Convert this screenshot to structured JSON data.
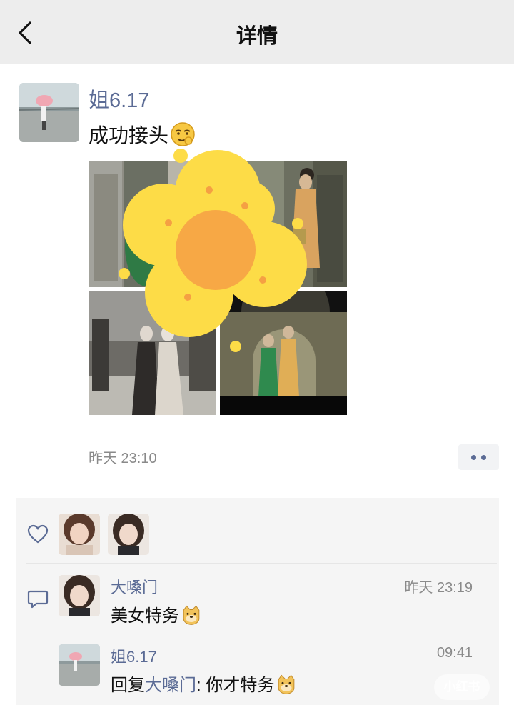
{
  "header": {
    "title": "详情"
  },
  "post": {
    "author": "姐6.17",
    "text": "成功接头",
    "time": "昨天 23:10"
  },
  "comments": [
    {
      "name": "大嗓门",
      "time": "昨天 23:19",
      "text": "美女特务"
    },
    {
      "name": "姐6.17",
      "time": "09:41",
      "reply_prefix": "回复",
      "reply_to": "大嗓门",
      "reply_sep": ": ",
      "text": "你才特务"
    }
  ],
  "watermark": "小红书",
  "icons": {
    "back": "back-chevron-icon",
    "like": "heart-icon",
    "comment": "comment-icon",
    "more": "more-dots-icon",
    "emoji_post": "smirk-emoji-icon",
    "emoji_comment": "dog-emoji-icon"
  },
  "colors": {
    "link": "#5b6b95",
    "header_bg": "#ededed",
    "panel_bg": "#f5f5f5"
  }
}
